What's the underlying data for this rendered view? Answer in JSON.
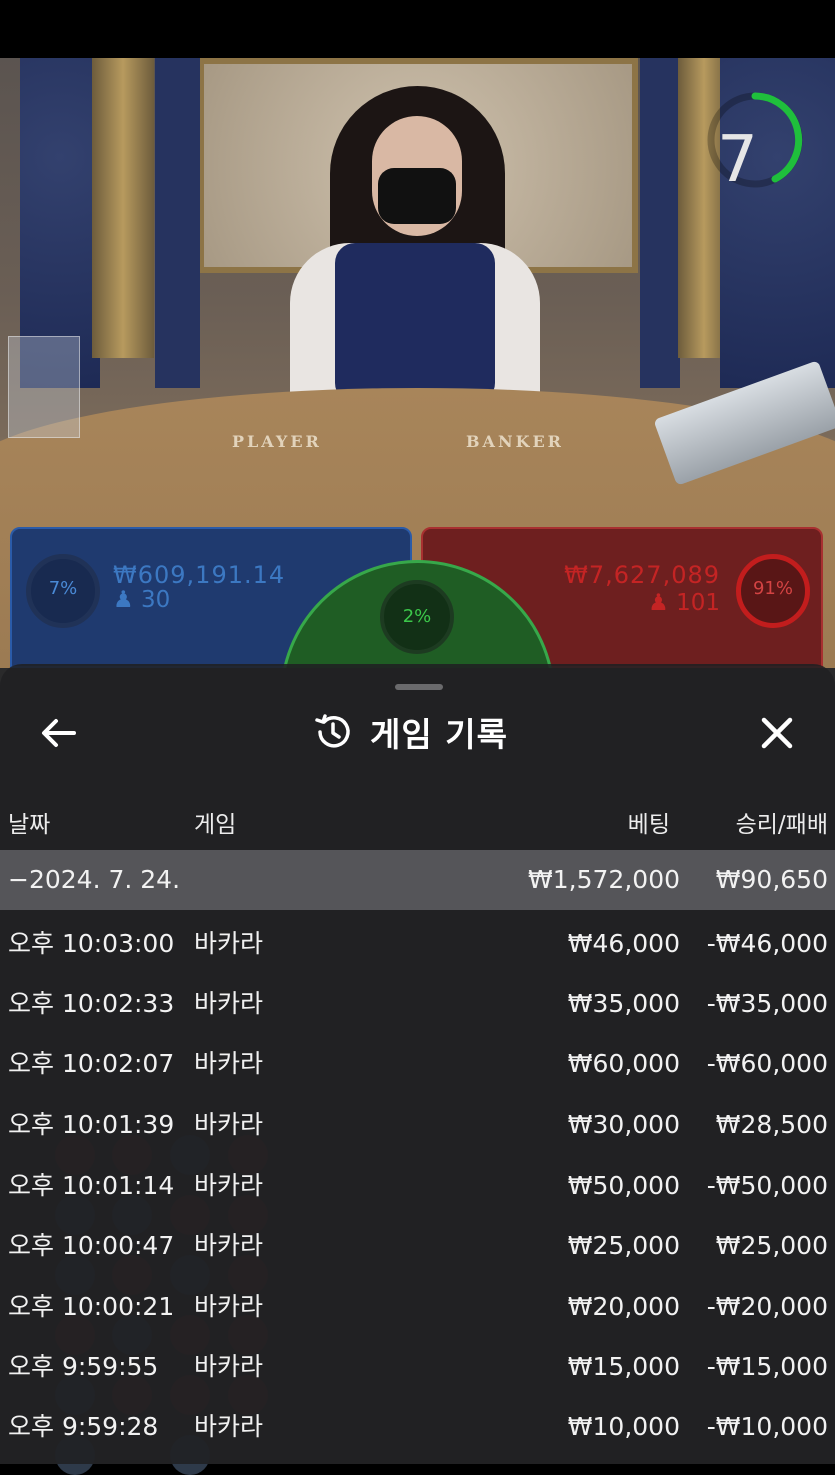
{
  "live": {
    "timer": "7",
    "timer_color": "#1fbf3c",
    "table_labels": {
      "player": "PLAYER",
      "banker": "BANKER"
    }
  },
  "betting": {
    "player": {
      "percent": "7%",
      "amount": "₩609,191.14",
      "players": "30",
      "color": "#2b5ba8"
    },
    "tie": {
      "percent": "2%",
      "color": "#37a84a"
    },
    "banker": {
      "percent": "91%",
      "amount": "₩7,627,089",
      "players": "101",
      "color": "#a83030"
    }
  },
  "history": {
    "title": "게임 기록",
    "icons": {
      "back": "arrow-left-icon",
      "history": "history-clock-icon",
      "close": "close-icon"
    },
    "columns": {
      "date": "날짜",
      "game": "게임",
      "bet": "베팅",
      "result": "승리/패배"
    },
    "summary": {
      "date": "−2024. 7. 24.",
      "bet": "₩1,572,000",
      "result": "₩90,650"
    },
    "rows": [
      {
        "time": "오후 10:03:00",
        "game": "바카라",
        "bet": "₩46,000",
        "result": "-₩46,000"
      },
      {
        "time": "오후 10:02:33",
        "game": "바카라",
        "bet": "₩35,000",
        "result": "-₩35,000"
      },
      {
        "time": "오후 10:02:07",
        "game": "바카라",
        "bet": "₩60,000",
        "result": "-₩60,000"
      },
      {
        "time": "오후 10:01:39",
        "game": "바카라",
        "bet": "₩30,000",
        "result": "₩28,500"
      },
      {
        "time": "오후 10:01:14",
        "game": "바카라",
        "bet": "₩50,000",
        "result": "-₩50,000"
      },
      {
        "time": "오후 10:00:47",
        "game": "바카라",
        "bet": "₩25,000",
        "result": "₩25,000"
      },
      {
        "time": "오후 10:00:21",
        "game": "바카라",
        "bet": "₩20,000",
        "result": "-₩20,000"
      },
      {
        "time": "오후 9:59:55",
        "game": "바카라",
        "bet": "₩15,000",
        "result": "-₩15,000"
      },
      {
        "time": "오후 9:59:28",
        "game": "바카라",
        "bet": "₩10,000",
        "result": "-₩10,000"
      }
    ]
  }
}
